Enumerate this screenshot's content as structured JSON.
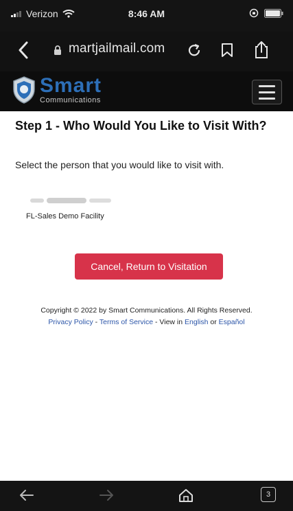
{
  "status_bar": {
    "carrier": "Verizon",
    "time": "8:46 AM"
  },
  "browser": {
    "url": "martjailmail.com",
    "tab_count": "3"
  },
  "header": {
    "logo_brand": "Smart",
    "logo_sub": "Communications"
  },
  "main": {
    "step_title": "Step 1 - Who Would You Like to Visit With?",
    "description": "Select the person that you would like to visit with.",
    "facility": "FL-Sales Demo Facility",
    "cancel_label": "Cancel, Return to Visitation"
  },
  "footer": {
    "copyright": "Copyright © 2022 by Smart Communications. All Rights Reserved.",
    "privacy": "Privacy Policy",
    "sep1": " - ",
    "terms": "Terms of Service",
    "view_in": " - View in ",
    "english": "English",
    "or": " or ",
    "espanol": "Español"
  },
  "colors": {
    "accent_red": "#d7334a",
    "brand_blue": "#2d6fb8",
    "link_blue": "#2b55a8"
  }
}
